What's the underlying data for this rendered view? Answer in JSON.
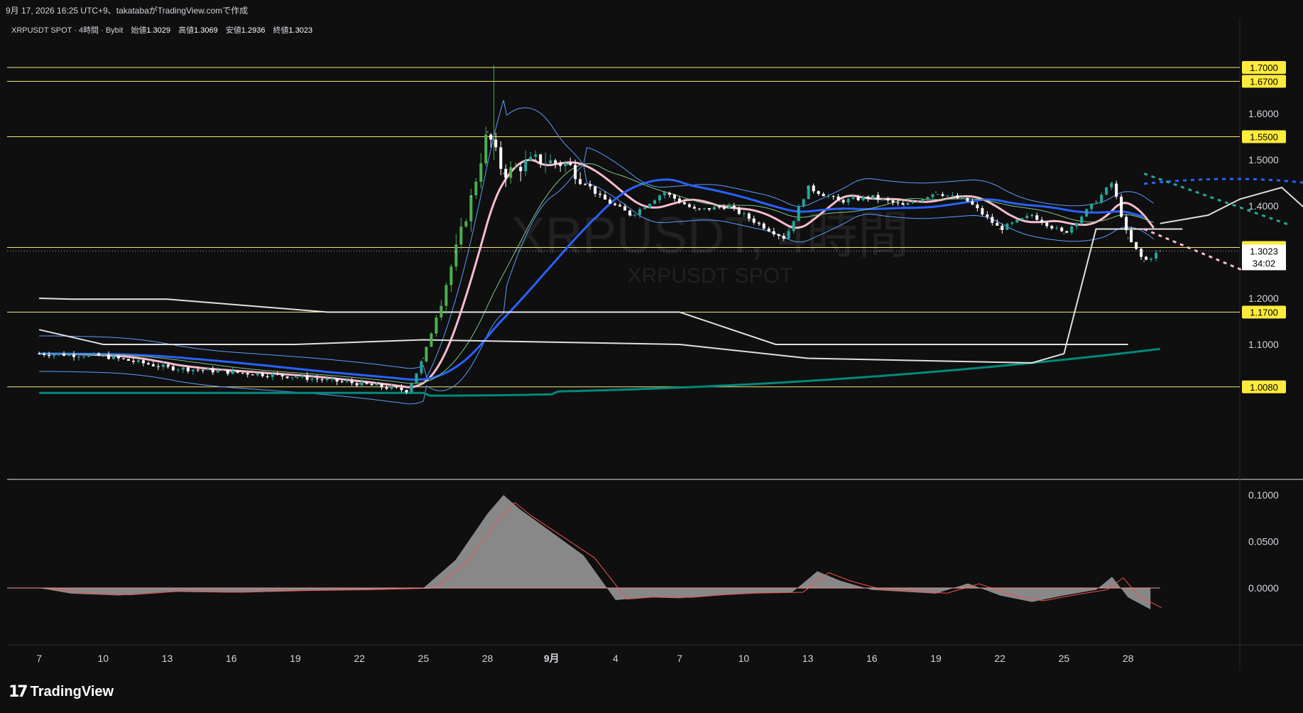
{
  "header": {
    "caption": "9月 17, 2026 16:25 UTC+9、takatabaがTradingView.comで作成"
  },
  "legend": {
    "symbol_line": "XRPUSDT SPOT · 4時間 · Bybit",
    "open_label": "始値",
    "open_value": "1.3029",
    "high_label": "高値",
    "high_value": "1.3069",
    "low_label": "安値",
    "low_value": "1.2936",
    "close_label": "終値",
    "close_value": "1.3023"
  },
  "watermark": {
    "line1": "XRPUSDT, 4時間",
    "line2": "XRPUSDT SPOT"
  },
  "brand": {
    "name": "TradingView"
  },
  "colors": {
    "background": "#0f0f0f",
    "candle_up": "#26a69a",
    "candle_up_bright": "#4caf50",
    "candle_down": "#ffffff",
    "level_line": "#f5e67a",
    "level_badge": "#ffeb3b",
    "ma_blue": "#2962ff",
    "ma_pink": "#f8bbd0",
    "ma_teal": "#00897b",
    "white_line": "#e0e0e0"
  },
  "chart_data": {
    "type": "candlestick",
    "symbol": "XRPUSDT",
    "timeframe": "4時間",
    "exchange": "Bybit",
    "x_ticks": [
      "7",
      "10",
      "13",
      "16",
      "19",
      "22",
      "25",
      "28",
      "9月",
      "4",
      "7",
      "10",
      "13",
      "16",
      "19",
      "22",
      "25",
      "28"
    ],
    "y_ticks": [
      "1.6000",
      "1.5000",
      "1.4000",
      "1.2000",
      "1.1000"
    ],
    "ylim": [
      0.93,
      1.78
    ],
    "horizontal_levels": [
      1.7,
      1.67,
      1.55,
      1.31,
      1.17,
      1.008
    ],
    "level_labels": [
      "1.7000",
      "1.6700",
      "1.5500",
      "1.3100",
      "1.1700",
      "1.0080"
    ],
    "last_price": "1.3023",
    "last_price_value": 1.3023,
    "countdown": "34:02",
    "ohlc_key_points": [
      {
        "t": 0,
        "p": 1.08
      },
      {
        "t": 2,
        "p": 1.075
      },
      {
        "t": 4,
        "p": 1.05
      },
      {
        "t": 6,
        "p": 1.04
      },
      {
        "t": 8,
        "p": 1.03
      },
      {
        "t": 10,
        "p": 1.015
      },
      {
        "t": 11.5,
        "p": 1.0
      },
      {
        "t": 12,
        "p": 1.07
      },
      {
        "t": 13,
        "p": 1.3
      },
      {
        "t": 13.5,
        "p": 1.42
      },
      {
        "t": 14,
        "p": 1.56
      },
      {
        "t": 14.5,
        "p": 1.47
      },
      {
        "t": 15.5,
        "p": 1.5
      },
      {
        "t": 16.5,
        "p": 1.49
      },
      {
        "t": 17.5,
        "p": 1.42
      },
      {
        "t": 18.5,
        "p": 1.38
      },
      {
        "t": 19.5,
        "p": 1.43
      },
      {
        "t": 20.5,
        "p": 1.39
      },
      {
        "t": 21.5,
        "p": 1.4
      },
      {
        "t": 22.5,
        "p": 1.36
      },
      {
        "t": 23.3,
        "p": 1.33
      },
      {
        "t": 24,
        "p": 1.44
      },
      {
        "t": 25,
        "p": 1.41
      },
      {
        "t": 26,
        "p": 1.42
      },
      {
        "t": 27,
        "p": 1.4
      },
      {
        "t": 28,
        "p": 1.43
      },
      {
        "t": 29,
        "p": 1.41
      },
      {
        "t": 30,
        "p": 1.35
      },
      {
        "t": 31,
        "p": 1.38
      },
      {
        "t": 32,
        "p": 1.34
      },
      {
        "t": 33,
        "p": 1.41
      },
      {
        "t": 33.5,
        "p": 1.45
      },
      {
        "t": 34,
        "p": 1.33
      },
      {
        "t": 34.5,
        "p": 1.28
      },
      {
        "t": 35,
        "p": 1.302
      }
    ],
    "oscillator": {
      "y_ticks": [
        "0.1000",
        "0.0500",
        "0.0000"
      ],
      "ylim": [
        -0.04,
        0.11
      ],
      "values": [
        {
          "t": 0,
          "v": 0.0
        },
        {
          "t": 1,
          "v": -0.006
        },
        {
          "t": 2.5,
          "v": -0.008
        },
        {
          "t": 4,
          "v": -0.004
        },
        {
          "t": 6,
          "v": -0.005
        },
        {
          "t": 8,
          "v": -0.003
        },
        {
          "t": 10,
          "v": -0.002
        },
        {
          "t": 12,
          "v": 0.0
        },
        {
          "t": 13,
          "v": 0.03
        },
        {
          "t": 14,
          "v": 0.08
        },
        {
          "t": 14.5,
          "v": 0.1
        },
        {
          "t": 15,
          "v": 0.085
        },
        {
          "t": 16,
          "v": 0.06
        },
        {
          "t": 17,
          "v": 0.035
        },
        {
          "t": 18,
          "v": -0.013
        },
        {
          "t": 19,
          "v": -0.01
        },
        {
          "t": 20,
          "v": -0.011
        },
        {
          "t": 21,
          "v": -0.008
        },
        {
          "t": 22,
          "v": -0.006
        },
        {
          "t": 23.5,
          "v": -0.005
        },
        {
          "t": 24.3,
          "v": 0.018
        },
        {
          "t": 25,
          "v": 0.008
        },
        {
          "t": 26,
          "v": -0.002
        },
        {
          "t": 27,
          "v": -0.004
        },
        {
          "t": 28,
          "v": -0.006
        },
        {
          "t": 29,
          "v": 0.005
        },
        {
          "t": 30,
          "v": -0.008
        },
        {
          "t": 31,
          "v": -0.015
        },
        {
          "t": 32,
          "v": -0.008
        },
        {
          "t": 33,
          "v": -0.002
        },
        {
          "t": 33.5,
          "v": 0.012
        },
        {
          "t": 34,
          "v": -0.01
        },
        {
          "t": 34.7,
          "v": -0.023
        }
      ]
    }
  }
}
